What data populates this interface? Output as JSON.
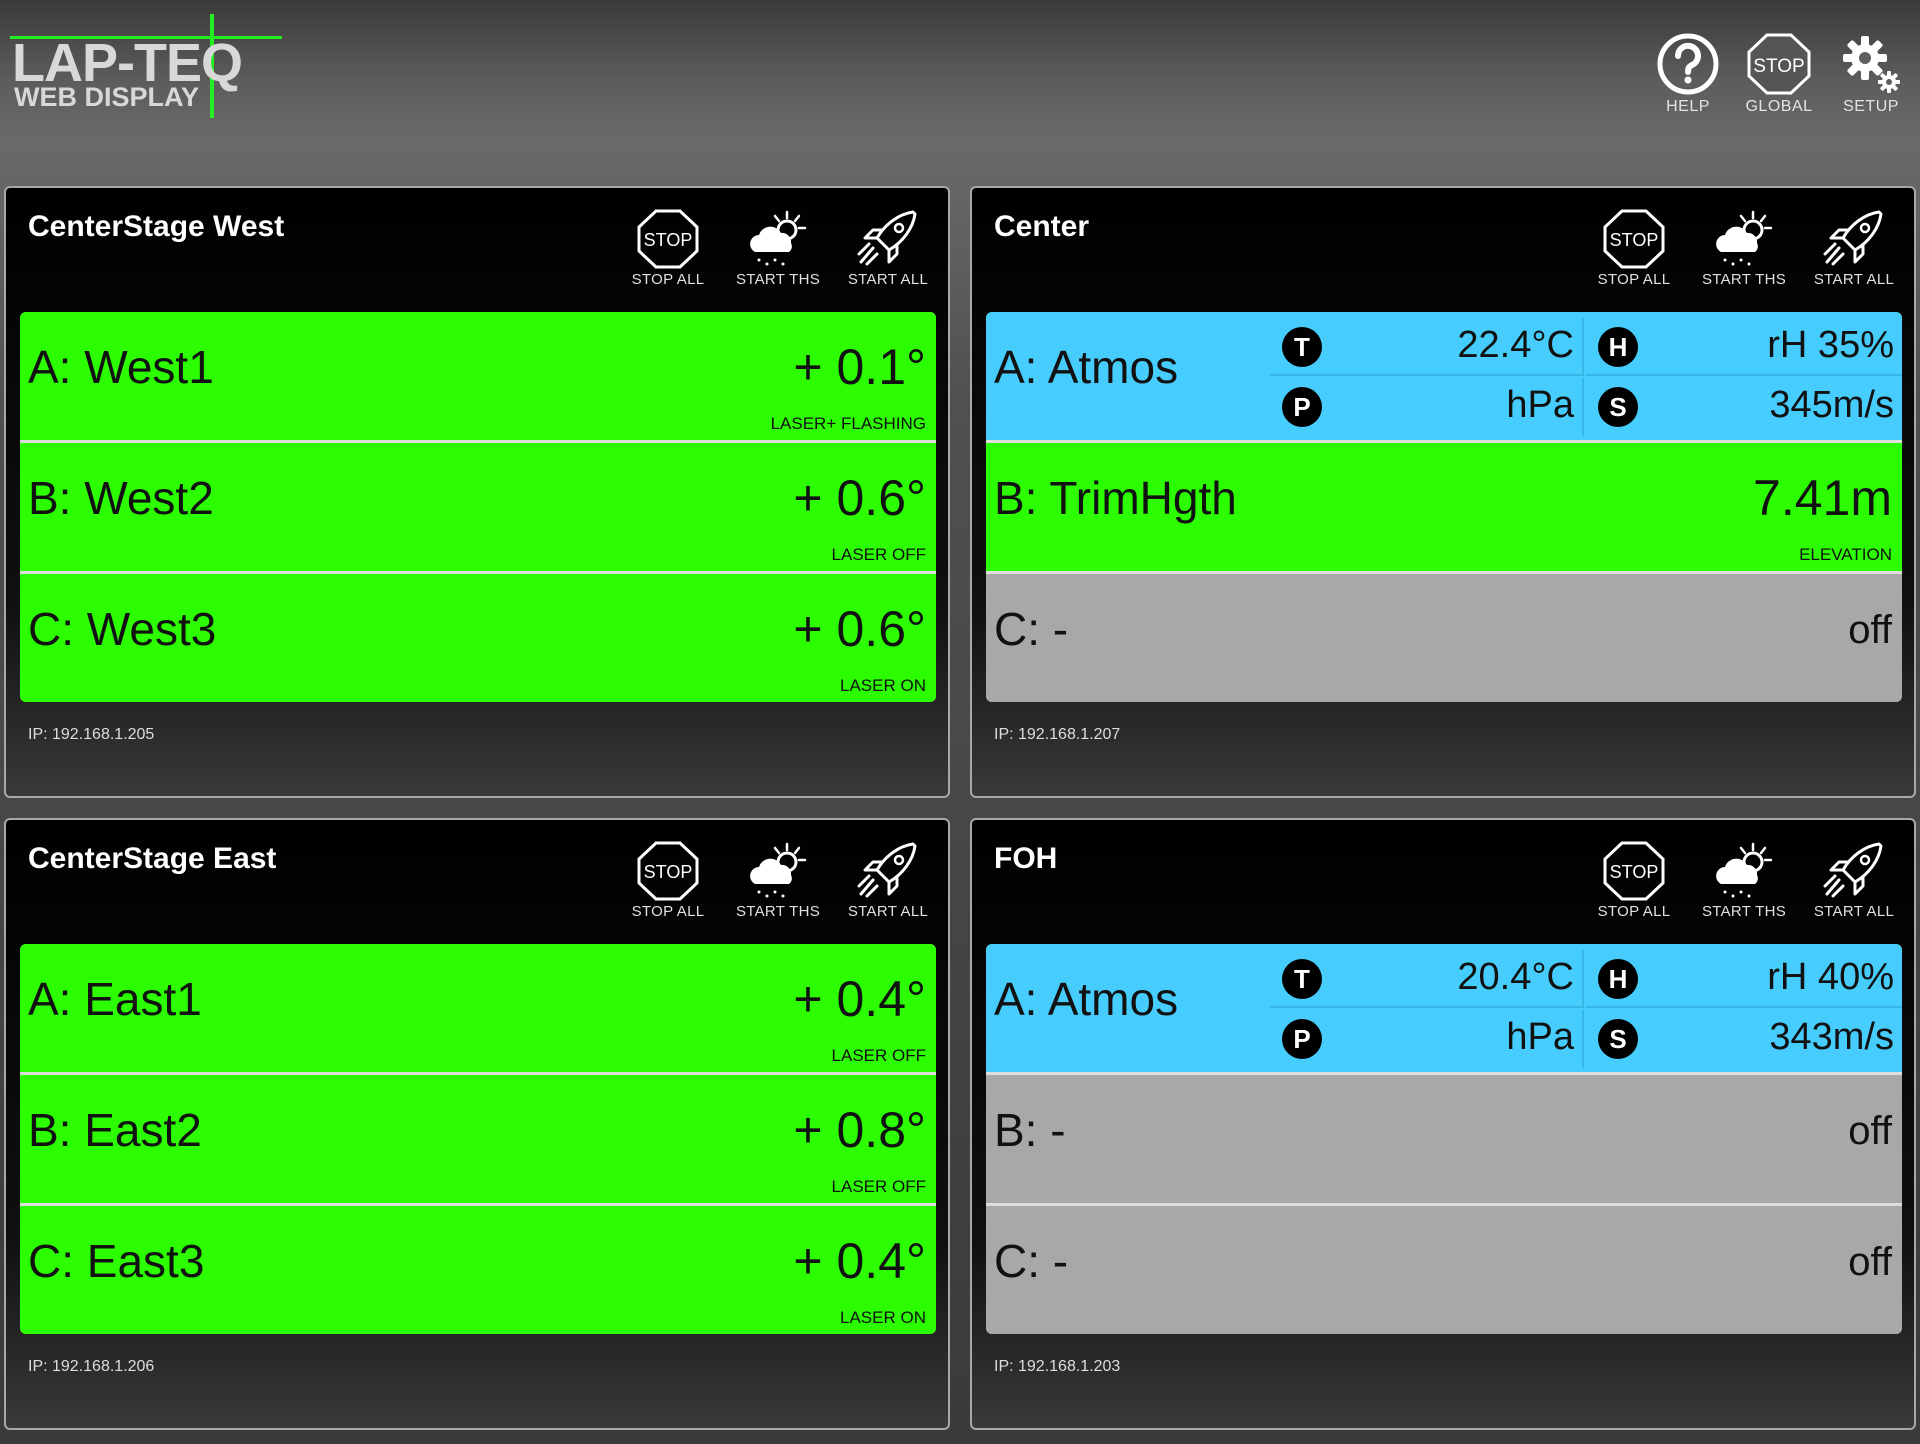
{
  "app": {
    "logo_title": "LAP-TEQ",
    "logo_subtitle": "WEB DISPLAY",
    "accent": "#22ee22"
  },
  "toolbar": {
    "help_label": "HELP",
    "global_stop_label": "GLOBAL",
    "setup_label": "SETUP",
    "stop_sign_text": "STOP"
  },
  "colors": {
    "ok_green": "#2cfd00",
    "off_gray": "#a8a8a8",
    "atmos_blue": "#46cdfd"
  },
  "panels": [
    {
      "title": "CenterStage West",
      "buttons": {
        "stop_all": "STOP ALL",
        "start_ths": "START THS",
        "start_all": "START ALL",
        "stop_sign": "STOP"
      },
      "ip": "IP: 192.168.1.205",
      "channels": [
        {
          "name": "A: West1",
          "value": "+ 0.1°",
          "status": "LASER+ FLASHING",
          "state": "green"
        },
        {
          "name": "B: West2",
          "value": "+ 0.6°",
          "status": "LASER OFF",
          "state": "green"
        },
        {
          "name": "C: West3",
          "value": "+ 0.6°",
          "status": "LASER ON",
          "state": "green"
        }
      ]
    },
    {
      "title": "Center",
      "buttons": {
        "stop_all": "STOP ALL",
        "start_ths": "START THS",
        "start_all": "START ALL",
        "stop_sign": "STOP"
      },
      "ip": "IP: 192.168.1.207",
      "atmos": {
        "name": "A: Atmos",
        "t_icon": "T",
        "t_value": "22.4°C",
        "h_icon": "H",
        "h_value": "rH 35%",
        "p_icon": "P",
        "p_value": "hPa",
        "s_icon": "S",
        "s_value": "345m/s"
      },
      "channels": [
        {
          "name": "B: TrimHgth",
          "value": "7.41m",
          "status": "ELEVATION",
          "state": "green"
        },
        {
          "name": "C: -",
          "value": "off",
          "status": "",
          "state": "gray"
        }
      ]
    },
    {
      "title": "CenterStage East",
      "buttons": {
        "stop_all": "STOP ALL",
        "start_ths": "START THS",
        "start_all": "START ALL",
        "stop_sign": "STOP"
      },
      "ip": "IP: 192.168.1.206",
      "channels": [
        {
          "name": "A: East1",
          "value": "+ 0.4°",
          "status": "LASER OFF",
          "state": "green"
        },
        {
          "name": "B: East2",
          "value": "+ 0.8°",
          "status": "LASER OFF",
          "state": "green"
        },
        {
          "name": "C: East3",
          "value": "+ 0.4°",
          "status": "LASER ON",
          "state": "green"
        }
      ]
    },
    {
      "title": "FOH",
      "buttons": {
        "stop_all": "STOP ALL",
        "start_ths": "START THS",
        "start_all": "START ALL",
        "stop_sign": "STOP"
      },
      "ip": "IP: 192.168.1.203",
      "atmos": {
        "name": "A: Atmos",
        "t_icon": "T",
        "t_value": "20.4°C",
        "h_icon": "H",
        "h_value": "rH 40%",
        "p_icon": "P",
        "p_value": "hPa",
        "s_icon": "S",
        "s_value": "343m/s"
      },
      "channels": [
        {
          "name": "B: -",
          "value": "off",
          "status": "",
          "state": "gray"
        },
        {
          "name": "C: -",
          "value": "off",
          "status": "",
          "state": "gray"
        }
      ]
    }
  ]
}
